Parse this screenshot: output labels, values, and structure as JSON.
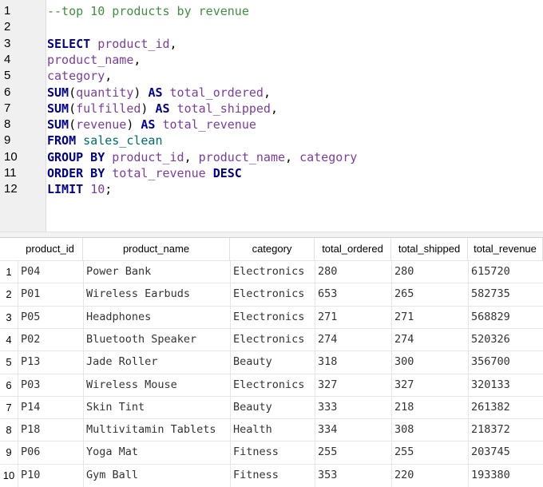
{
  "editor": {
    "line_numbers": [
      "1",
      "2",
      "3",
      "4",
      "5",
      "6",
      "7",
      "8",
      "9",
      "10",
      "11",
      "12"
    ],
    "lines": [
      [
        {
          "t": "--top 10 products by revenue",
          "c": "cm"
        }
      ],
      [],
      [
        {
          "t": "SELECT",
          "c": "kw"
        },
        {
          "t": " ",
          "c": "pl"
        },
        {
          "t": "product_id",
          "c": "id"
        },
        {
          "t": ",",
          "c": "pl"
        }
      ],
      [
        {
          "t": "product_name",
          "c": "id"
        },
        {
          "t": ",",
          "c": "pl"
        }
      ],
      [
        {
          "t": "category",
          "c": "id"
        },
        {
          "t": ",",
          "c": "pl"
        }
      ],
      [
        {
          "t": "SUM",
          "c": "kw"
        },
        {
          "t": "(",
          "c": "pl"
        },
        {
          "t": "quantity",
          "c": "id"
        },
        {
          "t": ") ",
          "c": "pl"
        },
        {
          "t": "AS",
          "c": "kw"
        },
        {
          "t": " ",
          "c": "pl"
        },
        {
          "t": "total_ordered",
          "c": "id"
        },
        {
          "t": ",",
          "c": "pl"
        }
      ],
      [
        {
          "t": "SUM",
          "c": "kw"
        },
        {
          "t": "(",
          "c": "pl"
        },
        {
          "t": "fulfilled",
          "c": "id"
        },
        {
          "t": ") ",
          "c": "pl"
        },
        {
          "t": "AS",
          "c": "kw"
        },
        {
          "t": " ",
          "c": "pl"
        },
        {
          "t": "total_shipped",
          "c": "id"
        },
        {
          "t": ",",
          "c": "pl"
        }
      ],
      [
        {
          "t": "SUM",
          "c": "kw"
        },
        {
          "t": "(",
          "c": "pl"
        },
        {
          "t": "revenue",
          "c": "id"
        },
        {
          "t": ") ",
          "c": "pl"
        },
        {
          "t": "AS",
          "c": "kw"
        },
        {
          "t": " ",
          "c": "pl"
        },
        {
          "t": "total_revenue",
          "c": "id"
        }
      ],
      [
        {
          "t": "FROM",
          "c": "kw"
        },
        {
          "t": " ",
          "c": "pl"
        },
        {
          "t": "sales_clean",
          "c": "tb"
        }
      ],
      [
        {
          "t": "GROUP BY",
          "c": "kw"
        },
        {
          "t": " ",
          "c": "pl"
        },
        {
          "t": "product_id",
          "c": "id"
        },
        {
          "t": ", ",
          "c": "pl"
        },
        {
          "t": "product_name",
          "c": "id"
        },
        {
          "t": ", ",
          "c": "pl"
        },
        {
          "t": "category",
          "c": "id"
        }
      ],
      [
        {
          "t": "ORDER BY",
          "c": "kw"
        },
        {
          "t": " ",
          "c": "pl"
        },
        {
          "t": "total_revenue",
          "c": "id"
        },
        {
          "t": " ",
          "c": "pl"
        },
        {
          "t": "DESC",
          "c": "kw"
        }
      ],
      [
        {
          "t": "LIMIT",
          "c": "kw"
        },
        {
          "t": " ",
          "c": "pl"
        },
        {
          "t": "10",
          "c": "nm"
        },
        {
          "t": ";",
          "c": "pl"
        }
      ]
    ]
  },
  "results": {
    "columns": [
      "product_id",
      "product_name",
      "category",
      "total_ordered",
      "total_shipped",
      "total_revenue"
    ],
    "rows": [
      {
        "n": "1",
        "cells": [
          "P04",
          "Power Bank",
          "Electronics",
          "280",
          "280",
          "615720"
        ]
      },
      {
        "n": "2",
        "cells": [
          "P01",
          "Wireless Earbuds",
          "Electronics",
          "653",
          "265",
          "582735"
        ]
      },
      {
        "n": "3",
        "cells": [
          "P05",
          "Headphones",
          "Electronics",
          "271",
          "271",
          "568829"
        ]
      },
      {
        "n": "4",
        "cells": [
          "P02",
          "Bluetooth Speaker",
          "Electronics",
          "274",
          "274",
          "520326"
        ]
      },
      {
        "n": "5",
        "cells": [
          "P13",
          "Jade Roller",
          "Beauty",
          "318",
          "300",
          "356700"
        ]
      },
      {
        "n": "6",
        "cells": [
          "P03",
          "Wireless Mouse",
          "Electronics",
          "327",
          "327",
          "320133"
        ]
      },
      {
        "n": "7",
        "cells": [
          "P14",
          "Skin Tint",
          "Beauty",
          "333",
          "218",
          "261382"
        ]
      },
      {
        "n": "8",
        "cells": [
          "P18",
          "Multivitamin Tablets",
          "Health",
          "334",
          "308",
          "218372"
        ]
      },
      {
        "n": "9",
        "cells": [
          "P06",
          "Yoga Mat",
          "Fitness",
          "255",
          "255",
          "203745"
        ]
      },
      {
        "n": "10",
        "cells": [
          "P10",
          "Gym Ball",
          "Fitness",
          "353",
          "220",
          "193380"
        ]
      }
    ]
  },
  "colors": {
    "keyword": "#00008b",
    "identifier": "#7a3e9d",
    "comment": "#3f8f3f",
    "table": "#006b6b",
    "gutter": "#f0f0f0"
  }
}
